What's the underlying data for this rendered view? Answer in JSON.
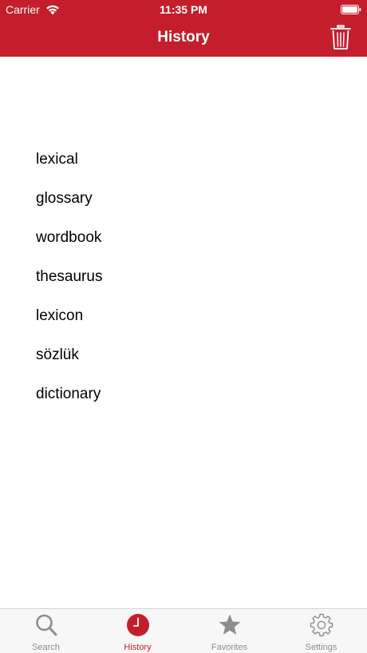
{
  "status_bar": {
    "carrier": "Carrier",
    "time": "11:35 PM",
    "wifi_icon": "wifi-icon",
    "battery_icon": "battery-icon"
  },
  "nav": {
    "title": "History",
    "trash_icon": "trash-icon"
  },
  "history": {
    "items": [
      {
        "label": "lexical"
      },
      {
        "label": "glossary"
      },
      {
        "label": "wordbook"
      },
      {
        "label": "thesaurus"
      },
      {
        "label": "lexicon"
      },
      {
        "label": "sözlük"
      },
      {
        "label": "dictionary"
      }
    ]
  },
  "tabbar": {
    "tabs": [
      {
        "label": "Search",
        "icon": "search-icon",
        "active": false
      },
      {
        "label": "History",
        "icon": "clock-icon",
        "active": true
      },
      {
        "label": "Favorites",
        "icon": "star-icon",
        "active": false
      },
      {
        "label": "Settings",
        "icon": "gear-icon",
        "active": false
      }
    ]
  },
  "colors": {
    "accent": "#c41e2c",
    "inactive": "#8e8e8e",
    "tabbar_bg": "#f7f7f7"
  }
}
